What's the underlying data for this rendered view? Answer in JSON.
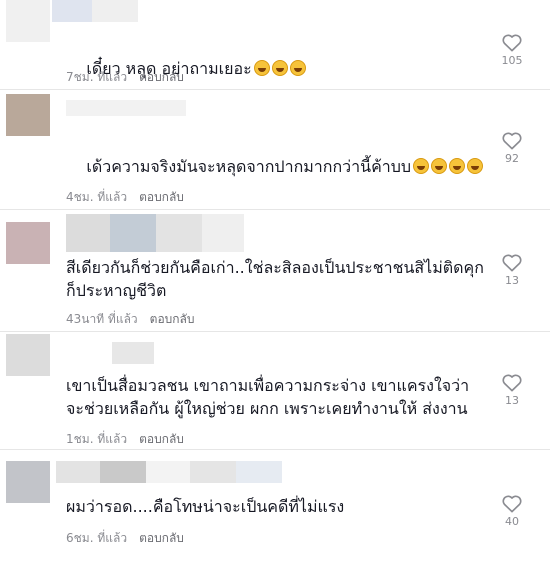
{
  "comments": [
    {
      "text": "เดี๋ยว หลุด อย่าถามเยอะ",
      "emoji_count": 3,
      "time": "7ชม. ที่แล้ว",
      "reply_label": "ตอบกลับ",
      "likes": "105",
      "redacted_colors": {
        "avatar": "#f0f0f0",
        "name": [
          "#dfe4ef",
          "#efefef",
          "#e8e8e8"
        ]
      }
    },
    {
      "text": "เด้วความจริงมันจะหลุดจากปากมากกว่านี้ค้าบบ",
      "emoji_count": 4,
      "time": "4ชม. ที่แล้ว",
      "reply_label": "ตอบกลับ",
      "likes": "92",
      "redacted_colors": {
        "avatar": "#b9a89a",
        "name": [
          "#f2f2f2"
        ]
      }
    },
    {
      "text": "สีเดียวกันก็ช่วยกันคือเก่า..ใช่ละสิลองเป็นประชาชนสิไม่ติดคุกก็ประหาญชีวิต",
      "emoji_count": 0,
      "time": "43นาที ที่แล้ว",
      "reply_label": "ตอบกลับ",
      "likes": "13",
      "redacted_colors": {
        "avatar": "#c9b2b4",
        "name": [
          "#dcdcdc",
          "#c3ccd6",
          "#e3e3e3",
          "#efefef"
        ]
      }
    },
    {
      "text": "เขาเป็นสื่อมวลชน เขาถามเพื่อความกระจ่าง เขาแครงใจว่าจะช่วยเหลือกัน ผู้ใหญ่ช่วย ผกก เพราะเคยทำงานให้ ส่งงาน",
      "emoji_count": 0,
      "time": "1ชม. ที่แล้ว",
      "reply_label": "ตอบกลับ",
      "likes": "13",
      "redacted_colors": {
        "avatar": "#dcdcdc",
        "name": [
          "#e7e7e7"
        ]
      }
    },
    {
      "text": "ผมว่ารอด....คือโทษน่าจะเป็นคดีที่ไม่แรง",
      "emoji_count": 0,
      "time": "6ชม. ที่แล้ว",
      "reply_label": "ตอบกลับ",
      "likes": "40",
      "redacted_colors": {
        "avatar": "#c2c4c9",
        "name": [
          "#e3e3e3",
          "#c9c9c9",
          "#f3f3f3",
          "#e5e5e5",
          "#e6ebf2"
        ]
      }
    }
  ],
  "icons": {
    "like": "heart-outline-icon",
    "emoji": "grinning-sweat-emoji"
  }
}
